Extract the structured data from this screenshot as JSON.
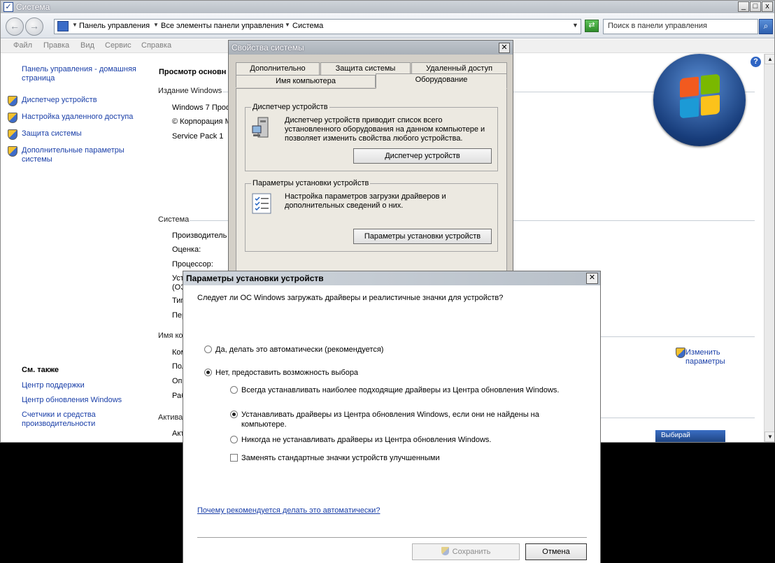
{
  "window": {
    "title": "Система",
    "controls": [
      "_",
      "□",
      "x"
    ]
  },
  "navbar": {
    "back_icon": "←",
    "forward_icon": "→",
    "breadcrumbs": [
      "Панель управления",
      "Все элементы панели управления",
      "Система"
    ],
    "search_placeholder": "Поиск в панели управления"
  },
  "menu": [
    "Файл",
    "Правка",
    "Вид",
    "Сервис",
    "Справка"
  ],
  "sidebar": {
    "home_link": "Панель управления - домашняя страница",
    "tasks": [
      {
        "label": "Диспетчер устройств",
        "icon": "shield-icon"
      },
      {
        "label": "Настройка удаленного доступа",
        "icon": "shield-icon"
      },
      {
        "label": "Защита системы",
        "icon": "shield-icon"
      },
      {
        "label": "Дополнительные параметры системы",
        "icon": "shield-icon"
      }
    ],
    "see_also_heading": "См. также",
    "see_also": [
      "Центр поддержки",
      "Центр обновления Windows",
      "Счетчики и средства производительности"
    ]
  },
  "main": {
    "heading": "Просмотр основн",
    "edition_label": "Издание Windows",
    "edition_rows": [
      "Windows 7 Проф",
      "© Корпорация М",
      "Service Pack 1"
    ],
    "system_label": "Система",
    "system_rows": [
      "Производитель",
      "Оценка:",
      "Процессор:",
      "Уст",
      "(ОЗ",
      "Тип",
      "Пер"
    ],
    "computer_label": "Имя ком",
    "computer_rows": [
      "Ком",
      "Пол",
      "Опи",
      "Раб"
    ],
    "activation_label": "Актива",
    "activation_rows": [
      "Акт"
    ],
    "change_settings": "Изменить параметры",
    "banner": "Выбирай"
  },
  "sysprops": {
    "title": "Свойства системы",
    "tabs_top": [
      "Дополнительно",
      "Защита системы",
      "Удаленный доступ"
    ],
    "tabs_bottom": [
      "Имя компьютера",
      "Оборудование"
    ],
    "device_manager": {
      "title": "Диспетчер устройств",
      "description": "Диспетчер устройств приводит список всего установленного оборудования на данном компьютере и позволяет изменить свойства любого устройства.",
      "button": "Диспетчер устройств"
    },
    "install_settings": {
      "title": "Параметры установки устройств",
      "description": "Настройка параметров загрузки драйверов и дополнительных сведений о них.",
      "button": "Параметры установки устройств"
    }
  },
  "devdlg": {
    "title": "Параметры установки устройств",
    "question": "Следует ли ОС Windows загружать драйверы и реалистичные значки для устройств?",
    "option_auto": "Да, делать это автоматически (рекомендуется)",
    "option_manual": "Нет, предоставить возможность выбора",
    "sub_always": "Всегда устанавливать наиболее подходящие драйверы из Центра обновления Windows.",
    "sub_if_missing": "Устанавливать драйверы из Центра обновления Windows, если они не найдены на компьютере.",
    "sub_never": "Никогда не устанавливать драйверы из Центра обновления Windows.",
    "checkbox_icons": "Заменять стандартные значки устройств улучшенными",
    "why_link": "Почему рекомендуется делать это автоматически?",
    "save_button": "Сохранить",
    "cancel_button": "Отмена"
  }
}
